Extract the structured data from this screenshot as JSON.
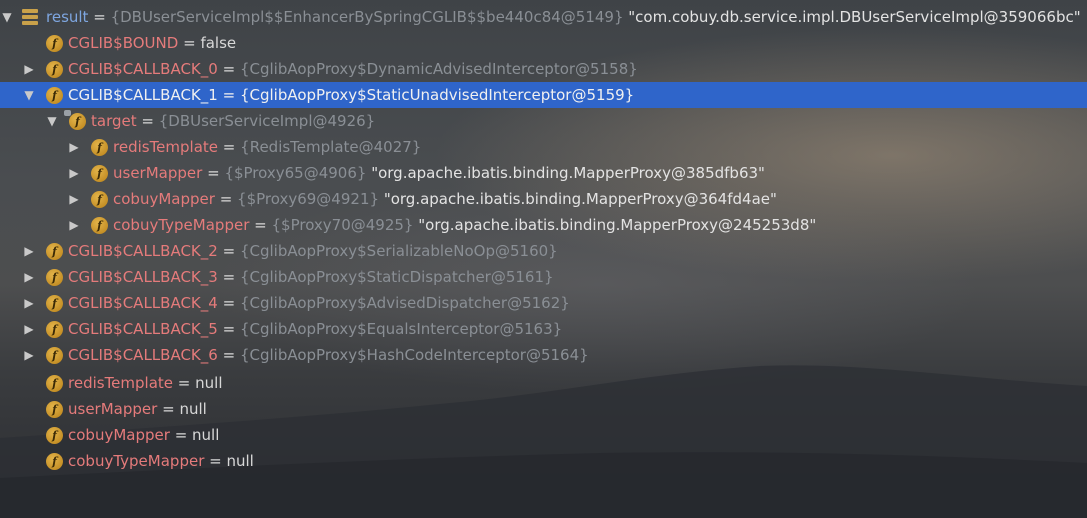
{
  "rows": [
    {
      "toggle": "▼",
      "icon": "list",
      "name": "result",
      "ref": "{DBUserServiceImpl$$EnhancerBySpringCGLIB$$be440c84@5149}",
      "value": "\"com.cobuy.db.service.impl.DBUserServiceImpl@359066bc\""
    },
    {
      "toggle": "",
      "icon": "f",
      "name": "CGLIB$BOUND",
      "ref": "",
      "value": "false"
    },
    {
      "toggle": "▶",
      "icon": "f",
      "name": "CGLIB$CALLBACK_0",
      "ref": "{CglibAopProxy$DynamicAdvisedInterceptor@5158}",
      "value": ""
    },
    {
      "toggle": "▼",
      "icon": "f",
      "name": "CGLIB$CALLBACK_1",
      "ref": "{CglibAopProxy$StaticUnadvisedInterceptor@5159}",
      "value": "",
      "selected": true
    },
    {
      "toggle": "▼",
      "icon": "f-locked",
      "name": "target",
      "ref": "{DBUserServiceImpl@4926}",
      "value": ""
    },
    {
      "toggle": "▶",
      "icon": "f",
      "name": "redisTemplate",
      "ref": "{RedisTemplate@4027}",
      "value": ""
    },
    {
      "toggle": "▶",
      "icon": "f",
      "name": "userMapper",
      "ref": "{$Proxy65@4906}",
      "value": "\"org.apache.ibatis.binding.MapperProxy@385dfb63\""
    },
    {
      "toggle": "▶",
      "icon": "f",
      "name": "cobuyMapper",
      "ref": "{$Proxy69@4921}",
      "value": "\"org.apache.ibatis.binding.MapperProxy@364fd4ae\""
    },
    {
      "toggle": "▶",
      "icon": "f",
      "name": "cobuyTypeMapper",
      "ref": "{$Proxy70@4925}",
      "value": "\"org.apache.ibatis.binding.MapperProxy@245253d8\""
    },
    {
      "toggle": "▶",
      "icon": "f",
      "name": "CGLIB$CALLBACK_2",
      "ref": "{CglibAopProxy$SerializableNoOp@5160}",
      "value": ""
    },
    {
      "toggle": "▶",
      "icon": "f",
      "name": "CGLIB$CALLBACK_3",
      "ref": "{CglibAopProxy$StaticDispatcher@5161}",
      "value": ""
    },
    {
      "toggle": "▶",
      "icon": "f",
      "name": "CGLIB$CALLBACK_4",
      "ref": "{CglibAopProxy$AdvisedDispatcher@5162}",
      "value": ""
    },
    {
      "toggle": "▶",
      "icon": "f",
      "name": "CGLIB$CALLBACK_5",
      "ref": "{CglibAopProxy$EqualsInterceptor@5163}",
      "value": ""
    },
    {
      "toggle": "▶",
      "icon": "f",
      "name": "CGLIB$CALLBACK_6",
      "ref": "{CglibAopProxy$HashCodeInterceptor@5164}",
      "value": ""
    },
    {
      "toggle": "",
      "icon": "f",
      "name": "redisTemplate",
      "ref": "",
      "value": "null"
    },
    {
      "toggle": "",
      "icon": "f",
      "name": "userMapper",
      "ref": "",
      "value": "null"
    },
    {
      "toggle": "",
      "icon": "f",
      "name": "cobuyMapper",
      "ref": "",
      "value": "null"
    },
    {
      "toggle": "",
      "icon": "f",
      "name": "cobuyTypeMapper",
      "ref": "",
      "value": "null"
    }
  ],
  "equals": "=",
  "icon_f_letter": "f",
  "colors": {
    "field_name": "#e57b7b",
    "root_name": "#7ea6e0",
    "reference": "#8a8f95",
    "selection": "#2f65ca"
  }
}
